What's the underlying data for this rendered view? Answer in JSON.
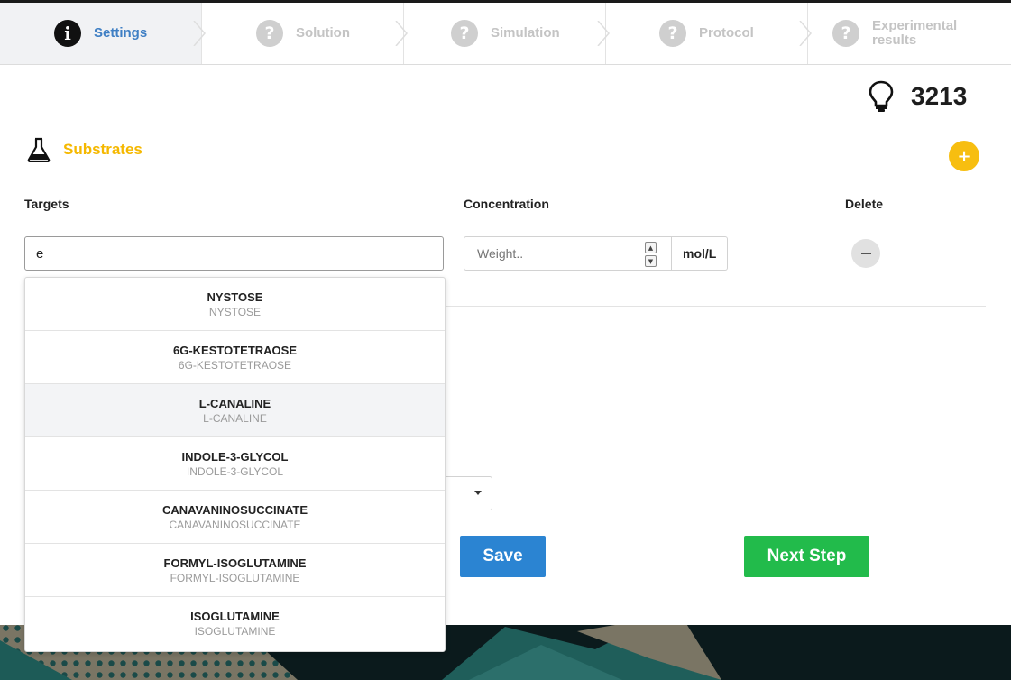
{
  "steps": [
    {
      "label": "Settings",
      "icon": "info-icon",
      "glyph": "i",
      "active": true
    },
    {
      "label": "Solution",
      "icon": "question-icon",
      "glyph": "?",
      "active": false
    },
    {
      "label": "Simulation",
      "icon": "question-icon",
      "glyph": "?",
      "active": false
    },
    {
      "label": "Protocol",
      "icon": "question-icon",
      "glyph": "?",
      "active": false
    },
    {
      "label": "Experimental results",
      "icon": "question-icon",
      "glyph": "?",
      "active": false
    }
  ],
  "counter": {
    "icon": "lightbulb-icon",
    "value": "3213"
  },
  "substrates": {
    "icon": "flask-icon",
    "title": "Substrates",
    "add_icon": "plus-icon",
    "add_label": "+",
    "columns": {
      "targets": "Targets",
      "concentration": "Concentration",
      "delete": "Delete"
    },
    "target_value": "e",
    "concentration_placeholder": "Weight..",
    "unit": "mol/L"
  },
  "dropdown": {
    "options": [
      {
        "name": "NYSTOSE",
        "sub": "NYSTOSE"
      },
      {
        "name": "6G-KESTOTETRAOSE",
        "sub": "6G-KESTOTETRAOSE"
      },
      {
        "name": "L-CANALINE",
        "sub": "L-CANALINE"
      },
      {
        "name": "INDOLE-3-GLYCOL",
        "sub": "INDOLE-3-GLYCOL"
      },
      {
        "name": "CANAVANINOSUCCINATE",
        "sub": "CANAVANINOSUCCINATE"
      },
      {
        "name": "FORMYL-ISOGLUTAMINE",
        "sub": "FORMYL-ISOGLUTAMINE"
      },
      {
        "name": "ISOGLUTAMINE",
        "sub": "ISOGLUTAMINE"
      }
    ],
    "hovered_index": 2
  },
  "actions": {
    "save_label": "Save",
    "next_label": "Next Step"
  },
  "colors": {
    "accent_blue": "#3f7fc4",
    "substrates_yellow": "#f5b800",
    "save_blue": "#2b84d2",
    "next_green": "#22bb4b"
  }
}
